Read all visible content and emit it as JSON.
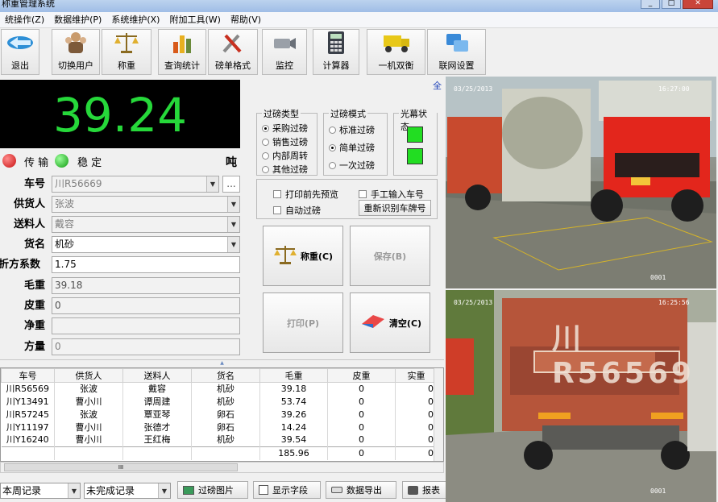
{
  "window": {
    "title": "称重管理系统"
  },
  "menu": [
    "统操作(Z)",
    "数据维护(P)",
    "系统维护(X)",
    "附加工具(W)",
    "帮助(V)"
  ],
  "toolbar": {
    "items": [
      {
        "label": "退出",
        "icon": "exit-icon"
      },
      {
        "label": "切换用户",
        "icon": "users-icon"
      },
      {
        "label": "称重",
        "icon": "scale-icon"
      },
      {
        "label": "查询统计",
        "icon": "chart-icon"
      },
      {
        "label": "磅单格式",
        "icon": "tools-icon"
      },
      {
        "label": "监控",
        "icon": "camera-icon"
      },
      {
        "label": "计算器",
        "icon": "calculator-icon"
      },
      {
        "label": "一机双衡",
        "icon": "truck-icon"
      },
      {
        "label": "联网设置",
        "icon": "network-icon"
      }
    ]
  },
  "display": {
    "weight": "39.24",
    "full_link": "全"
  },
  "status": {
    "transmit": "传 输",
    "stable": "稳 定",
    "unit": "吨",
    "transmit_color": "#e02020",
    "stable_color": "#18c418"
  },
  "form": {
    "plate": {
      "label": "车号",
      "value": "川R56669",
      "btn": "..."
    },
    "supplier": {
      "label": "供货人",
      "value": "张波"
    },
    "shipper": {
      "label": "送料人",
      "value": "戴容"
    },
    "goods": {
      "label": "货名",
      "value": "机砂"
    },
    "factor": {
      "label": "折方系数",
      "value": "1.75"
    },
    "gross": {
      "label": "毛重",
      "value": "39.18"
    },
    "tare": {
      "label": "皮重",
      "value": "0"
    },
    "net": {
      "label": "净重",
      "value": ""
    },
    "volume": {
      "label": "方量",
      "value": "0"
    }
  },
  "weigh_type": {
    "title": "过磅类型",
    "options": [
      "采购过磅",
      "销售过磅",
      "内部周转",
      "其他过磅"
    ],
    "selected": 0
  },
  "weigh_mode": {
    "title": "过磅模式",
    "options": [
      "标准过磅",
      "简单过磅",
      "一次过磅"
    ],
    "selected": 1
  },
  "light_curtain": {
    "title": "光幕状态",
    "color": "#22dd22"
  },
  "checks": {
    "preview": "打印前先预览",
    "manual": "手工输入车号",
    "auto": "自动过磅",
    "recognize": "重新识别车牌号"
  },
  "actions": {
    "weigh": "称重(C)",
    "save": "保存(B)",
    "print": "打印(P)",
    "clear": "清空(C)"
  },
  "table": {
    "headers": [
      "车号",
      "供货人",
      "送料人",
      "货名",
      "毛重",
      "皮重",
      "实重"
    ],
    "rows": [
      [
        "川R56569",
        "张波",
        "戴容",
        "机砂",
        "39.18",
        "0",
        "0"
      ],
      [
        "川Y13491",
        "曹小川",
        "谭周建",
        "机砂",
        "53.74",
        "0",
        "0"
      ],
      [
        "川R57245",
        "张波",
        "覃亚琴",
        "卵石",
        "39.26",
        "0",
        "0"
      ],
      [
        "川Y11197",
        "曹小川",
        "张德才",
        "卵石",
        "14.24",
        "0",
        "0"
      ],
      [
        "川Y16240",
        "曹小川",
        "王红梅",
        "机砂",
        "39.54",
        "0",
        "0"
      ]
    ],
    "total": "185.96",
    "total_tare": "0",
    "total_net": "0",
    "scroll_marker": "III"
  },
  "bottom": {
    "period": "本周记录",
    "filter": "未完成记录",
    "photos": "过磅图片",
    "fields": "显示字段",
    "export": "数据导出",
    "report": "报表"
  },
  "cameras": [
    {
      "date": "03/25/2013",
      "time": "16:27:00",
      "name": "0001"
    },
    {
      "date": "03/25/2013",
      "time": "16:25:56",
      "name": "0001",
      "plate": "川R56569"
    }
  ]
}
